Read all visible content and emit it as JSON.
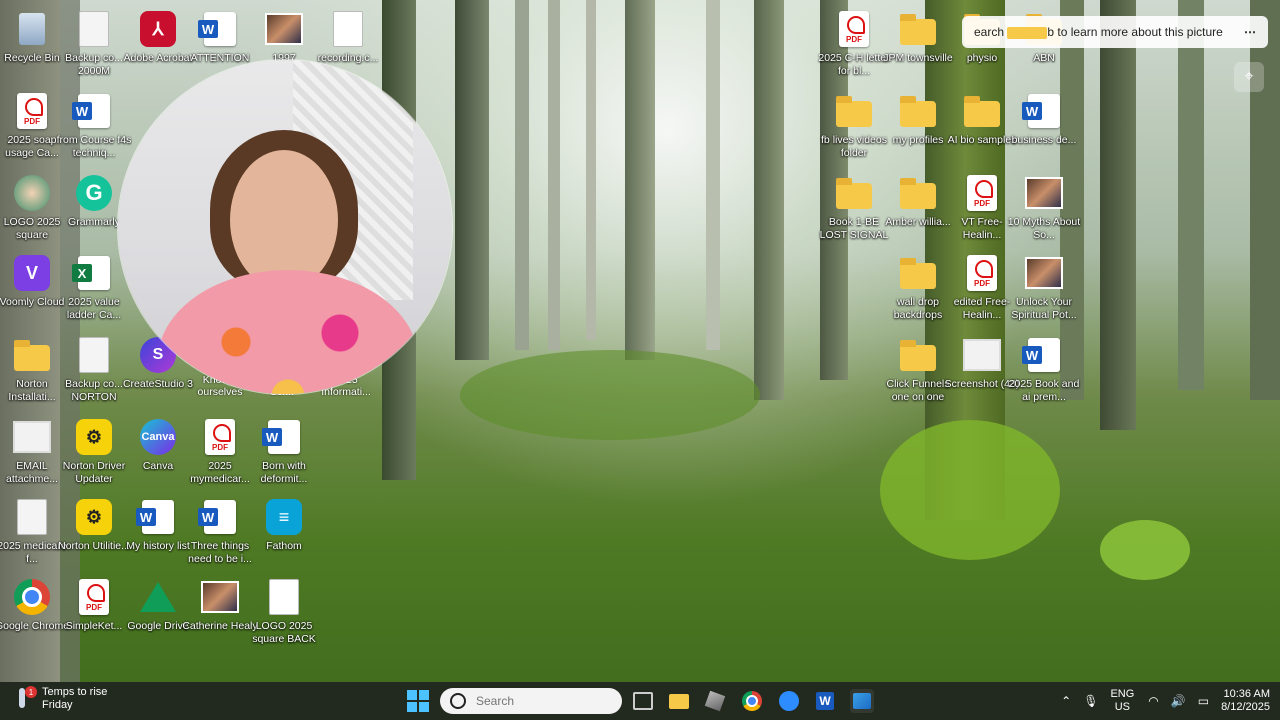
{
  "desktop_icons": [
    {
      "label": "Recycle Bin",
      "type": "recycle"
    },
    {
      "label": "Backup co... 2000M",
      "type": "doc"
    },
    {
      "label": "Adobe Acrobat",
      "type": "acrobat"
    },
    {
      "label": "ATTENTION",
      "type": "word"
    },
    {
      "label": "1997",
      "type": "photo"
    },
    {
      "label": "recording.c...",
      "type": "doc"
    },
    {
      "label": "2025 soap usage Ca...",
      "type": "pdf"
    },
    {
      "label": "from Course f4s techniq...",
      "type": "word"
    },
    {
      "label": "LOGO 2025 square",
      "type": "photo"
    },
    {
      "label": "Grammarly",
      "type": "grammarly"
    },
    {
      "label": "Voomly Cloud",
      "type": "voomly"
    },
    {
      "label": "2025 value ladder Ca...",
      "type": "excel"
    },
    {
      "label": "Norton Installati...",
      "type": "folder"
    },
    {
      "label": "Backup co... NORTON",
      "type": "doc"
    },
    {
      "label": "CreateStudio 3",
      "type": "createstudio"
    },
    {
      "label": "EMAIL attachme...",
      "type": "email"
    },
    {
      "label": "Norton Driver Updater",
      "type": "norton"
    },
    {
      "label": "Canva",
      "type": "canva"
    },
    {
      "label": "2025 mymedicar...",
      "type": "pdf"
    },
    {
      "label": "Born with deformit...",
      "type": "word"
    },
    {
      "label": "2025 medicare f...",
      "type": "doc"
    },
    {
      "label": "Norton Utilitie...",
      "type": "norton"
    },
    {
      "label": "My history list",
      "type": "word"
    },
    {
      "label": "Three things need to be i...",
      "type": "word"
    },
    {
      "label": "Fathom",
      "type": "fathom"
    },
    {
      "label": "Google Chrome",
      "type": "chrome"
    },
    {
      "label": "SimpleKet...",
      "type": "pdf"
    },
    {
      "label": "Google Drive",
      "type": "gdrive"
    },
    {
      "label": "Catherine Healy",
      "type": "photo"
    },
    {
      "label": "LOGO 2025 square BACK",
      "type": "doc"
    },
    {
      "label": "2025 C-H letter for bl...",
      "type": "pdf"
    },
    {
      "label": "JPM townsville",
      "type": "folder"
    },
    {
      "label": "physio",
      "type": "folder"
    },
    {
      "label": "ABN",
      "type": "folder"
    },
    {
      "label": "fb lives videos folder",
      "type": "folder"
    },
    {
      "label": "my profiles",
      "type": "folder"
    },
    {
      "label": "AI bio samples",
      "type": "folder"
    },
    {
      "label": "business de...",
      "type": "word"
    },
    {
      "label": "Book 1-BE LOST SIGNAL",
      "type": "folder"
    },
    {
      "label": "Amber willia...",
      "type": "folder"
    },
    {
      "label": "VT Free-Healin...",
      "type": "pdf"
    },
    {
      "label": "10 Myths About So...",
      "type": "photo"
    },
    {
      "label": "wall drop backdrops",
      "type": "folder"
    },
    {
      "label": "edited Free-Healin...",
      "type": "pdf"
    },
    {
      "label": "Unlock Your Spiritual Pot...",
      "type": "photo"
    },
    {
      "label": "Click Funnels one on one",
      "type": "folder"
    },
    {
      "label": "Screenshot (43)",
      "type": "email"
    },
    {
      "label": "2025 Book and ai prem...",
      "type": "word"
    }
  ],
  "hidden_labels": {
    "know_ourselves": "Know... ourselves",
    "scripts": "Script... Scr...",
    "informat": "2025 Informati..."
  },
  "visual_search": {
    "text": "Search the web to learn more about this picture",
    "text_visible": "earch",
    "text_tail": "b to learn more about this picture",
    "more": "⋯"
  },
  "taskbar": {
    "weather": {
      "line1": "Temps to rise",
      "line2": "Friday",
      "badge": "1"
    },
    "search_placeholder": "Search",
    "language": {
      "line1": "ENG",
      "line2": "US"
    },
    "clock": {
      "time": "10:36 AM",
      "date": "8/12/2025"
    }
  },
  "colors": {
    "taskbar": "#202420",
    "accent": "#4cc2ff",
    "folder": "#f7c948"
  }
}
